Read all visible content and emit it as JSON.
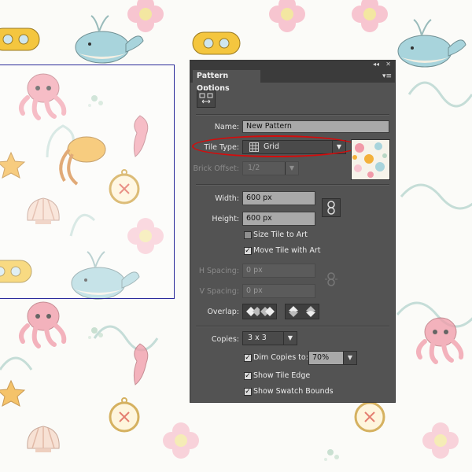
{
  "panel": {
    "title": "Pattern Options",
    "top_controls": {
      "collapse": "◂◂",
      "close": "✕"
    },
    "menu_icon": "▾≡",
    "tile_tool_icon": "pattern-tile-tool-icon",
    "name": {
      "label": "Name:",
      "value": "New Pattern"
    },
    "tile_type": {
      "label": "Tile Type:",
      "value": "Grid",
      "icon": "grid-icon"
    },
    "brick_offset": {
      "label": "Brick Offset:",
      "value": "1/2"
    },
    "width": {
      "label": "Width:",
      "value": "600 px"
    },
    "height": {
      "label": "Height:",
      "value": "600 px"
    },
    "size_tile_to_art": {
      "label": "Size Tile to Art",
      "checked": false
    },
    "move_tile_with_art": {
      "label": "Move Tile with Art",
      "checked": true
    },
    "h_spacing": {
      "label": "H Spacing:",
      "value": "0 px"
    },
    "v_spacing": {
      "label": "V Spacing:",
      "value": "0 px"
    },
    "overlap": {
      "label": "Overlap:"
    },
    "copies": {
      "label": "Copies:",
      "value": "3 x 3"
    },
    "dim_copies": {
      "label": "Dim Copies to:",
      "value": "70%",
      "checked": true
    },
    "show_tile_edge": {
      "label": "Show Tile Edge",
      "checked": true
    },
    "show_swatch_bounds": {
      "label": "Show Swatch Bounds",
      "checked": true
    },
    "check_glyph": "✓",
    "arrow_glyph": "▼"
  },
  "colors": {
    "panel_bg": "#535353",
    "highlight": "#d40c0c",
    "tile_edge": "#2a2a9a"
  }
}
